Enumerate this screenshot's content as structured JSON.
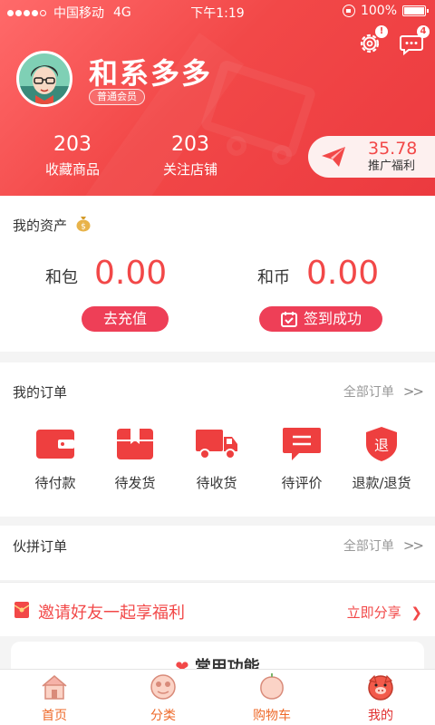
{
  "status_bar": {
    "carrier": "中国移动",
    "network": "4G",
    "time": "下午1:19",
    "battery": "100%"
  },
  "header": {
    "settings_badge": "!",
    "messages_badge": "4",
    "username": "和系多多",
    "member_level": "普通会员",
    "stats": [
      {
        "value": "203",
        "label": "收藏商品"
      },
      {
        "value": "203",
        "label": "关注店铺"
      }
    ],
    "promo": {
      "amount": "35.78",
      "label": "推广福利"
    }
  },
  "assets": {
    "title": "我的资产",
    "hebao": {
      "label": "和包",
      "value": "0.00",
      "button": "去充值"
    },
    "hebi": {
      "label": "和币",
      "value": "0.00",
      "button": "签到成功"
    }
  },
  "orders": {
    "title": "我的订单",
    "all_link": "全部订单",
    "arrow": ">>",
    "items": [
      {
        "label": "待付款",
        "icon": "wallet-icon"
      },
      {
        "label": "待发货",
        "icon": "package-icon"
      },
      {
        "label": "待收货",
        "icon": "truck-icon"
      },
      {
        "label": "待评价",
        "icon": "comment-icon"
      },
      {
        "label": "退款/退货",
        "icon": "refund-shield-icon"
      }
    ]
  },
  "group_orders": {
    "title": "伙拼订单",
    "all_link": "全部订单",
    "arrow": ">>"
  },
  "invite": {
    "text": "邀请好友一起享福利",
    "share": "立即分享"
  },
  "common_functions": {
    "title": "常用功能"
  },
  "tabbar": {
    "tabs": [
      {
        "label": "首页",
        "icon": "home-icon"
      },
      {
        "label": "分类",
        "icon": "category-icon"
      },
      {
        "label": "购物车",
        "icon": "cart-icon"
      },
      {
        "label": "我的",
        "icon": "profile-icon",
        "active": true
      }
    ]
  },
  "colors": {
    "brand_red": "#f24848",
    "button_red": "#ee3f57",
    "tab_orange": "#ee6a2a"
  }
}
